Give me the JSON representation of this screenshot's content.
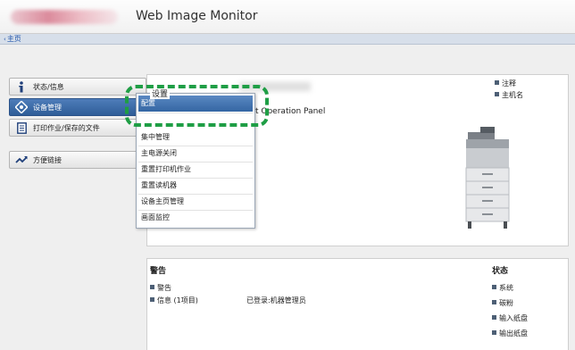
{
  "header": {
    "title": "Web Image Monitor"
  },
  "breadcrumb": {
    "home": "主页"
  },
  "sidebar": {
    "items": [
      {
        "label": "状态/信息"
      },
      {
        "label": "设备管理"
      },
      {
        "label": "打印作业/保存的文件"
      },
      {
        "label": "方便链接"
      }
    ]
  },
  "main": {
    "section_title": "设置",
    "subtitle": "t Operation Panel",
    "right_links": [
      "注释",
      "主机名"
    ]
  },
  "menu": {
    "items": [
      "配置",
      "集中管理",
      "主电源关闭",
      "重置打印机作业",
      "重置读机器",
      "设备主页管理",
      "画面监控"
    ]
  },
  "bottom": {
    "alert_title": "警告",
    "alert_links": [
      "警告",
      "信息 (1项目)"
    ],
    "login_text": "已登录:机器管理员",
    "status_title": "状态",
    "status_links": [
      "系统",
      "碳粉",
      "输入纸盘",
      "输出纸盘"
    ]
  },
  "colors": {
    "accent": "#2f5d97",
    "highlight": "#3466a3",
    "callout": "#1f9e45"
  }
}
